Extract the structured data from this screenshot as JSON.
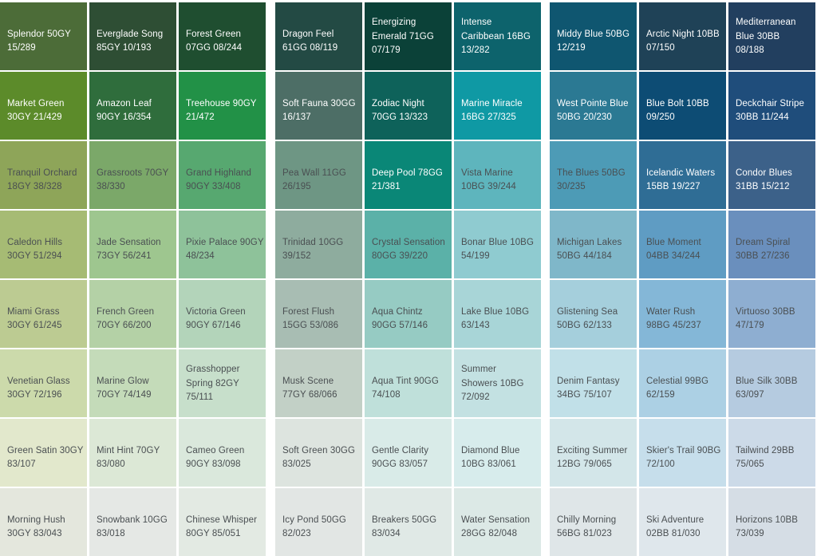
{
  "groups": [
    {
      "columns": [
        [
          {
            "lines": [
              "Splendor 50GY",
              "15/289"
            ],
            "color": "#4c6c38",
            "dark": true
          },
          {
            "lines": [
              "Market Green",
              "30GY 21/429"
            ],
            "color": "#5c8b2a",
            "dark": true
          },
          {
            "lines": [
              "Tranquil Orchard",
              "18GY 38/328"
            ],
            "color": "#8ea559",
            "dark": false
          },
          {
            "lines": [
              "Caledon Hills",
              "30GY 51/294"
            ],
            "color": "#a6bb74",
            "dark": false
          },
          {
            "lines": [
              "Miami Grass",
              "30GY 61/245"
            ],
            "color": "#bccb92",
            "dark": false
          },
          {
            "lines": [
              "Venetian Glass",
              "30GY 72/196"
            ],
            "color": "#ccdaab",
            "dark": false
          },
          {
            "lines": [
              "Green Satin 30GY",
              "83/107"
            ],
            "color": "#e2e8cc",
            "dark": false
          },
          {
            "lines": [
              "Morning Hush",
              "30GY 83/043"
            ],
            "color": "#e4e7dd",
            "dark": false
          }
        ],
        [
          {
            "lines": [
              "Everglade Song",
              "85GY 10/193"
            ],
            "color": "#2e4e34",
            "dark": true
          },
          {
            "lines": [
              "Amazon Leaf",
              "90GY 16/354"
            ],
            "color": "#2f6d3c",
            "dark": true
          },
          {
            "lines": [
              "Grassroots 70GY",
              "38/330"
            ],
            "color": "#7ba869",
            "dark": false
          },
          {
            "lines": [
              "Jade Sensation",
              "73GY 56/241"
            ],
            "color": "#9ec68f",
            "dark": false
          },
          {
            "lines": [
              "French Green",
              "70GY 66/200"
            ],
            "color": "#b4d1a6",
            "dark": false
          },
          {
            "lines": [
              "Marine Glow",
              "70GY 74/149"
            ],
            "color": "#c4dbb9",
            "dark": false
          },
          {
            "lines": [
              "Mint Hint 70GY",
              "83/080"
            ],
            "color": "#dce8d6",
            "dark": false
          },
          {
            "lines": [
              "Snowbank 10GG",
              "83/018"
            ],
            "color": "#e5e8e5",
            "dark": false
          }
        ],
        [
          {
            "lines": [
              "Forest Green",
              "07GG 08/244"
            ],
            "color": "#1f4e30",
            "dark": true
          },
          {
            "lines": [
              "Treehouse 90GY",
              "21/472"
            ],
            "color": "#229147",
            "dark": true
          },
          {
            "lines": [
              "Grand Highland",
              "90GY 33/408"
            ],
            "color": "#57a870",
            "dark": false
          },
          {
            "lines": [
              "Pixie Palace 90GY",
              "48/234"
            ],
            "color": "#8ec29a",
            "dark": false
          },
          {
            "lines": [
              "Victoria Green",
              "90GY 67/146"
            ],
            "color": "#b3d4ba",
            "dark": false
          },
          {
            "lines": [
              "Grasshopper",
              "Spring 82GY",
              "75/111"
            ],
            "color": "#c7dfcb",
            "dark": false
          },
          {
            "lines": [
              "Cameo Green",
              "90GY 83/098"
            ],
            "color": "#dae8dc",
            "dark": false
          },
          {
            "lines": [
              "Chinese Whisper",
              "80GY 85/051"
            ],
            "color": "#e3eae3",
            "dark": false
          }
        ]
      ]
    },
    {
      "columns": [
        [
          {
            "lines": [
              "Dragon Feel",
              "61GG 08/119"
            ],
            "color": "#234a44",
            "dark": true
          },
          {
            "lines": [
              "Soft Fauna 30GG",
              "16/137"
            ],
            "color": "#4d6e66",
            "dark": true
          },
          {
            "lines": [
              "Pea Wall 11GG",
              "26/195"
            ],
            "color": "#6e9684",
            "dark": false
          },
          {
            "lines": [
              "Trinidad 10GG",
              "39/152"
            ],
            "color": "#8eac9e",
            "dark": false
          },
          {
            "lines": [
              "Forest Flush",
              "15GG 53/086"
            ],
            "color": "#a8bdb3",
            "dark": false
          },
          {
            "lines": [
              "Musk Scene",
              "77GY 68/066"
            ],
            "color": "#c2d0c6",
            "dark": false
          },
          {
            "lines": [
              "Soft Green 30GG",
              "83/025"
            ],
            "color": "#dde4df",
            "dark": false
          },
          {
            "lines": [
              "Icy Pond 50GG",
              "82/023"
            ],
            "color": "#e2e6e4",
            "dark": false
          }
        ],
        [
          {
            "lines": [
              "Energizing",
              "Emerald 71GG",
              "07/179"
            ],
            "color": "#0b4138",
            "dark": true
          },
          {
            "lines": [
              "Zodiac Night",
              "70GG 13/323"
            ],
            "color": "#0e625a",
            "dark": true
          },
          {
            "lines": [
              "Deep Pool 78GG",
              "21/381"
            ],
            "color": "#0a8777",
            "dark": true
          },
          {
            "lines": [
              "Crystal Sensation",
              "80GG 39/220"
            ],
            "color": "#5bb1a8",
            "dark": false
          },
          {
            "lines": [
              "Aqua Chintz",
              "90GG 57/146"
            ],
            "color": "#96cbc3",
            "dark": false
          },
          {
            "lines": [
              "Aqua Tint 90GG",
              "74/108"
            ],
            "color": "#bfe0da",
            "dark": false
          },
          {
            "lines": [
              "Gentle Clarity",
              "90GG 83/057"
            ],
            "color": "#d9ebe8",
            "dark": false
          },
          {
            "lines": [
              "Breakers 50GG",
              "83/034"
            ],
            "color": "#e0e9e6",
            "dark": false
          }
        ],
        [
          {
            "lines": [
              "Intense",
              "Caribbean 16BG",
              "13/282"
            ],
            "color": "#0d636c",
            "dark": true
          },
          {
            "lines": [
              "Marine Miracle",
              "16BG 27/325"
            ],
            "color": "#0f99a4",
            "dark": true
          },
          {
            "lines": [
              "Vista Marine",
              "10BG 39/244"
            ],
            "color": "#5eb5bd",
            "dark": false
          },
          {
            "lines": [
              "Bonar Blue 10BG",
              "54/199"
            ],
            "color": "#8fcbd0",
            "dark": false
          },
          {
            "lines": [
              "Lake Blue 10BG",
              "63/143"
            ],
            "color": "#a8d5d7",
            "dark": false
          },
          {
            "lines": [
              "Summer",
              "Showers 10BG",
              "72/092"
            ],
            "color": "#c3e1e2",
            "dark": false
          },
          {
            "lines": [
              "Diamond Blue",
              "10BG 83/061"
            ],
            "color": "#d7ecec",
            "dark": false
          },
          {
            "lines": [
              "Water Sensation",
              "28GG 82/048"
            ],
            "color": "#dce9e6",
            "dark": false
          }
        ]
      ]
    },
    {
      "columns": [
        [
          {
            "lines": [
              "Middy Blue 50BG",
              "12/219"
            ],
            "color": "#0f5670",
            "dark": true
          },
          {
            "lines": [
              "West Pointe Blue",
              "50BG 20/230"
            ],
            "color": "#2b7993",
            "dark": true
          },
          {
            "lines": [
              "The Blues 50BG",
              "30/235"
            ],
            "color": "#4d9bb6",
            "dark": false
          },
          {
            "lines": [
              "Michigan Lakes",
              "50BG 44/184"
            ],
            "color": "#7fb7c9",
            "dark": false
          },
          {
            "lines": [
              "Glistening Sea",
              "50BG 62/133"
            ],
            "color": "#a5cfdc",
            "dark": false
          },
          {
            "lines": [
              "Denim Fantasy",
              "34BG 75/107"
            ],
            "color": "#c1e0e8",
            "dark": false
          },
          {
            "lines": [
              "Exciting Summer",
              "12BG 79/065"
            ],
            "color": "#d3e6e9",
            "dark": false
          },
          {
            "lines": [
              "Chilly Morning",
              "56BG 81/023"
            ],
            "color": "#dfe6e8",
            "dark": false
          }
        ],
        [
          {
            "lines": [
              "Arctic Night 10BB",
              "07/150"
            ],
            "color": "#1f4257",
            "dark": true
          },
          {
            "lines": [
              "Blue Bolt 10BB",
              "09/250"
            ],
            "color": "#0d4c74",
            "dark": true
          },
          {
            "lines": [
              "Icelandic Waters",
              "15BB 19/227"
            ],
            "color": "#2f6d95",
            "dark": true
          },
          {
            "lines": [
              "Blue Moment",
              "04BB 34/244"
            ],
            "color": "#5f9cc3",
            "dark": false
          },
          {
            "lines": [
              "Water Rush",
              "98BG 45/237"
            ],
            "color": "#84b7d7",
            "dark": false
          },
          {
            "lines": [
              "Celestial 99BG",
              "62/159"
            ],
            "color": "#acd0e4",
            "dark": false
          },
          {
            "lines": [
              "Skier's Trail 90BG",
              "72/100"
            ],
            "color": "#c6deeb",
            "dark": false
          },
          {
            "lines": [
              "Ski Adventure",
              "02BB 81/030"
            ],
            "color": "#dfe7ec",
            "dark": false
          }
        ],
        [
          {
            "lines": [
              "Mediterranean",
              "Blue 30BB",
              "08/188"
            ],
            "color": "#223f5f",
            "dark": true
          },
          {
            "lines": [
              "Deckchair Stripe",
              "30BB 11/244"
            ],
            "color": "#1f4d7b",
            "dark": true
          },
          {
            "lines": [
              "Condor Blues",
              "31BB 15/212"
            ],
            "color": "#3c6189",
            "dark": true
          },
          {
            "lines": [
              "Dream Spiral",
              "30BB 27/236"
            ],
            "color": "#6a8fbd",
            "dark": false
          },
          {
            "lines": [
              "Virtuoso 30BB",
              "47/179"
            ],
            "color": "#8eaed1",
            "dark": false
          },
          {
            "lines": [
              "Blue Silk 30BB",
              "63/097"
            ],
            "color": "#b5cbe0",
            "dark": false
          },
          {
            "lines": [
              "Tailwind 29BB",
              "75/065"
            ],
            "color": "#ccdae8",
            "dark": false
          },
          {
            "lines": [
              "Horizons 10BB",
              "73/039"
            ],
            "color": "#d5dde5",
            "dark": false
          }
        ]
      ]
    }
  ]
}
